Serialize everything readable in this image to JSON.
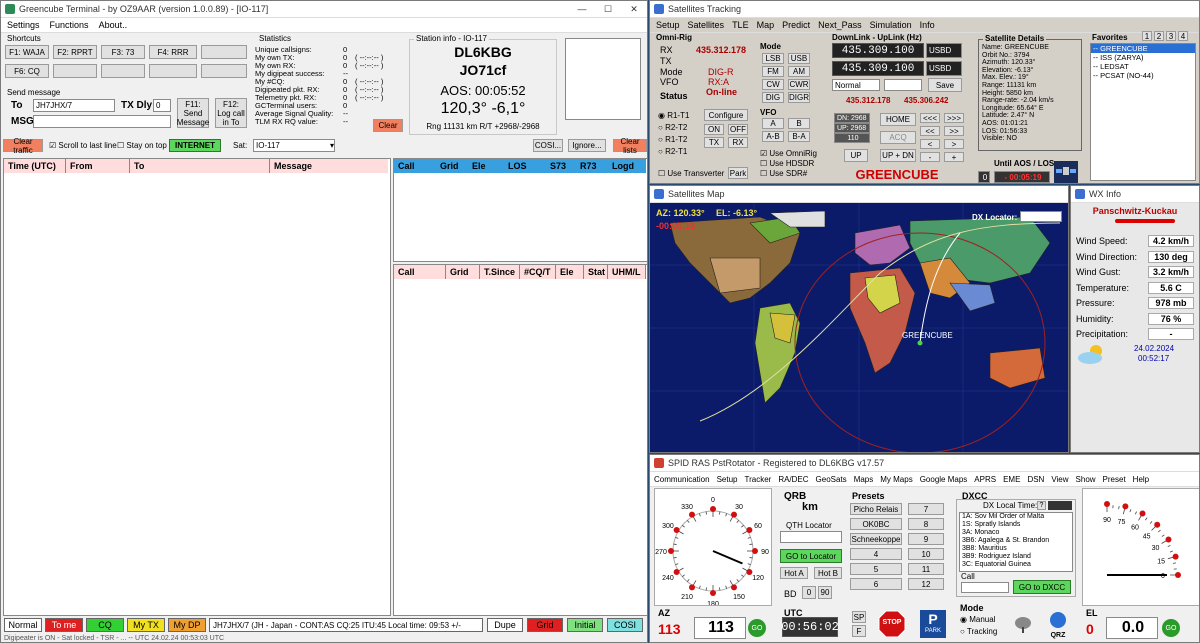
{
  "terminal": {
    "title": "Greencube Terminal - by OZ9AAR (version 1.0.0.89) - [IO-117]",
    "menu": [
      "Settings",
      "Functions",
      "About.."
    ],
    "shortcuts_title": "Shortcuts",
    "shortcuts": [
      "F1: WAJA",
      "F2: RPRT",
      "F3: 73",
      "F4: RRR",
      "F6: CQ"
    ],
    "stats_title": "Statistics",
    "stats": [
      {
        "label": "Unique callsigns:",
        "value": "0",
        "extra": ""
      },
      {
        "label": "My own TX:",
        "value": "0",
        "extra": "( --:--:-- )"
      },
      {
        "label": "My own RX:",
        "value": "0",
        "extra": "( --:--:-- )"
      },
      {
        "label": "My digipeat success:",
        "value": "--",
        "extra": ""
      },
      {
        "label": "My #CQ:",
        "value": "0",
        "extra": "( --:--:-- )"
      },
      {
        "label": "Digipeated pkt. RX:",
        "value": "0",
        "extra": "( --:--:-- )"
      },
      {
        "label": "Telemetry pkt. RX:",
        "value": "0",
        "extra": "( --:--:-- )"
      },
      {
        "label": "GCTerminal users:",
        "value": "0",
        "extra": ""
      },
      {
        "label": "Average Signal Quality:",
        "value": "--",
        "extra": ""
      },
      {
        "label": "TLM RX RQ value:",
        "value": "--",
        "extra": ""
      }
    ],
    "station_info_title": "Station info - IO-117",
    "callsign": "DL6KBG",
    "locator": "JO71cf",
    "aos": "AOS: 00:05:52",
    "az_el": "120,3°  -6,1°",
    "range": "Rng 11131 km R/T +2968/-2968",
    "clear_btn": "Clear",
    "send_title": "Send message",
    "to_label": "To",
    "to_value": "JH7JHX/7",
    "txdly_label": "TX Dly",
    "txdly_value": "0",
    "msg_label": "MSG",
    "f11": "F11: Send Message",
    "f12": "F12: Log call in To",
    "clear_traffic": "Clear traffic",
    "scroll_last": "Scroll to last line",
    "stay_top": "Stay on top",
    "internet": "INTERNET",
    "sat_label": "Sat:",
    "sat_value": "IO-117",
    "cosi_btn": "COSI...",
    "ignore_btn": "Ignore...",
    "clear_lists": "Clear lists",
    "msg_columns": [
      "Time (UTC)",
      "From",
      "To",
      "Message"
    ],
    "list1_columns": [
      "Call",
      "Grid",
      "Ele",
      "LOS",
      "S73",
      "R73",
      "Logd"
    ],
    "list2_columns": [
      "Call",
      "Grid",
      "T.Since",
      "#CQ/T",
      "Ele",
      "Stat",
      "UHM/L"
    ],
    "status_buttons": [
      "Normal",
      "To me",
      "CQ",
      "My TX",
      "My DP"
    ],
    "status_msg": "JH7JHX/7 (JH - Japan - CONT:AS CQ:25 ITU:45 Local time: 09:53 +/-",
    "status_buttons2": [
      "Dupe",
      "Grid",
      "Initial",
      "COSI"
    ],
    "bottom_status": "Digipeater is ON - Sat locked - TSR - ... -- UTC 24.02.24 00:53:03 UTC"
  },
  "tracking": {
    "title": "Satellites Tracking",
    "menu": [
      "Setup",
      "Satellites",
      "TLE",
      "Map",
      "Predict",
      "Next_Pass",
      "Simulation",
      "Info"
    ],
    "omni_title": "Omni-Rig",
    "rx_label": "RX",
    "rx_value": "435.312.178",
    "tx_label": "TX",
    "mode_label": "Mode",
    "mode_value": "DIG-R",
    "vfo_label": "VFO",
    "vfo_value": "RX:A",
    "status_label": "Status",
    "status_value": "On-line",
    "radios": [
      "R1-T1",
      "R2-T2",
      "R1-T2",
      "R2-T1"
    ],
    "configure": "Configure",
    "on": "ON",
    "off": "OFF",
    "txb": "TX",
    "rxb": "RX",
    "use_transverter": "Use Transverter",
    "park": "Park",
    "mode_title": "Mode",
    "modes": [
      "LSB",
      "USB",
      "FM",
      "AM",
      "CW",
      "CWR",
      "DIG",
      "DIGR"
    ],
    "vfo_title": "VFO",
    "vfo_btns": [
      "A",
      "B",
      "A-B",
      "B-A"
    ],
    "use_omnirig": "Use OmniRig",
    "use_hdsdr": "Use HDSDR",
    "use_sdr": "Use SDR#",
    "dl_ul_title": "DownLink - UpLink (Hz)",
    "dl_freq": "435.309.100",
    "ul_freq": "435.309.100",
    "usbd1": "USBD",
    "usbd2": "USBD",
    "normal": "Normal",
    "save": "Save",
    "f_left": "435.312.178",
    "f_right": "435.306.242",
    "dn_label": "DN: 2968",
    "up_label": "UP: 2968",
    "step": "110",
    "home": "HOME",
    "acq": "ACQ",
    "up_btn": "UP",
    "updn": "UP + DN",
    "sat_name": "GREENCUBE",
    "aos_los_label": "Until AOS / LOS",
    "aos_los_num": "0",
    "aos_los_time": "- 00:05:19",
    "details_title": "Satellite Details",
    "details": [
      "Name: GREENCUBE",
      "Orbit No.: 3794",
      "Azimuth: 120.33°",
      "Elevation: -6.13°",
      "Max. Elev.: 19°",
      "Range: 11131 km",
      "Height: 5850 km",
      "Range-rate: -2.04 km/s",
      "Longitude: 65.64° E",
      "Latitude: 2.47° N",
      "AOS: 01:01:21",
      "LOS: 01:56:33",
      "Visible: NO"
    ],
    "fav_title": "Favorites",
    "fav_tabs": [
      "1",
      "2",
      "3",
      "4"
    ],
    "favorites": [
      "-- GREENCUBE",
      "-- ISS (ZARYA)",
      "-- LEDSAT",
      "-- PCSAT (NO-44)"
    ]
  },
  "map": {
    "title": "Satellites Map",
    "az": "AZ: 120.33°",
    "el": "EL: -6.13°",
    "time": "-00:05:19",
    "dx_locator": "DX Locator:",
    "sat_label": "GREENCUBE"
  },
  "wx": {
    "title": "WX Info",
    "location": "Panschwitz-Kuckau",
    "rows": [
      {
        "k": "Wind Speed:",
        "v": "4.2 km/h"
      },
      {
        "k": "Wind Direction:",
        "v": "130 deg"
      },
      {
        "k": "Wind Gust:",
        "v": "3.2 km/h"
      },
      {
        "k": "Temperature:",
        "v": "5.6 C"
      },
      {
        "k": "Pressure:",
        "v": "978 mb"
      },
      {
        "k": "Humidity:",
        "v": "76 %"
      },
      {
        "k": "Precipitation:",
        "v": "-"
      }
    ],
    "date": "24.02.2024",
    "time": "00:52:17"
  },
  "rotator": {
    "title": "SPID RAS PstRotator - Registered to DL6KBG   v17.57",
    "menu": [
      "Communication",
      "Setup",
      "Tracker",
      "RA/DEC",
      "GeoSats",
      "Maps",
      "My Maps",
      "Google Maps",
      "APRS",
      "EME",
      "DSN",
      "View",
      "Show",
      "Preset",
      "Help"
    ],
    "az_ticks": [
      "0",
      "30",
      "60",
      "90",
      "120",
      "150",
      "180",
      "210",
      "240",
      "270",
      "300",
      "330"
    ],
    "qrb_title": "QRB",
    "qrb_unit": "km",
    "qth_locator": "QTH Locator",
    "go_locator": "GO to Locator",
    "hot_a": "Hot A",
    "hot_b": "Hot B",
    "bd_label": "BD",
    "bd_val": "0",
    "bd_90": "90",
    "presets_title": "Presets",
    "presets": [
      "Picho Relais",
      "7",
      "OK0BC",
      "8",
      "Schneekoppe",
      "9",
      "4",
      "10",
      "5",
      "11",
      "6",
      "12"
    ],
    "dxcc_title": "DXCC",
    "dx_local_time": "DX Local Time:",
    "dxcc_list": [
      "1A:  Sov Mil Order of Malta",
      "1S:  Spratly Islands",
      "3A:  Monaco",
      "3B6:  Agalega & St. Brandon",
      "3B8:  Mauritius",
      "3B9:  Rodriguez Island",
      "3C:  Equatorial Guinea"
    ],
    "call_label": "Call",
    "go_dxcc": "GO to DXCC",
    "az_label": "AZ",
    "az_target": "113",
    "az_value": "113",
    "utc_label": "UTC",
    "utc_value": "00:56:02",
    "sp": "SP",
    "f": "F",
    "stop": "STOP",
    "park": "PARK",
    "mode_title": "Mode",
    "mode_manual": "Manual",
    "mode_tracking": "Tracking",
    "qrz": "QRZ",
    "el_label": "EL",
    "el_target": "0",
    "el_value": "0.0",
    "el_ticks": [
      "0",
      "15",
      "30",
      "45",
      "60",
      "75",
      "90"
    ]
  },
  "colors": {
    "accent_red": "#d40000",
    "accent_green": "#2bbf2b",
    "dark_blue": "#1a2c5a",
    "header_blue": "#2a6fd4"
  }
}
